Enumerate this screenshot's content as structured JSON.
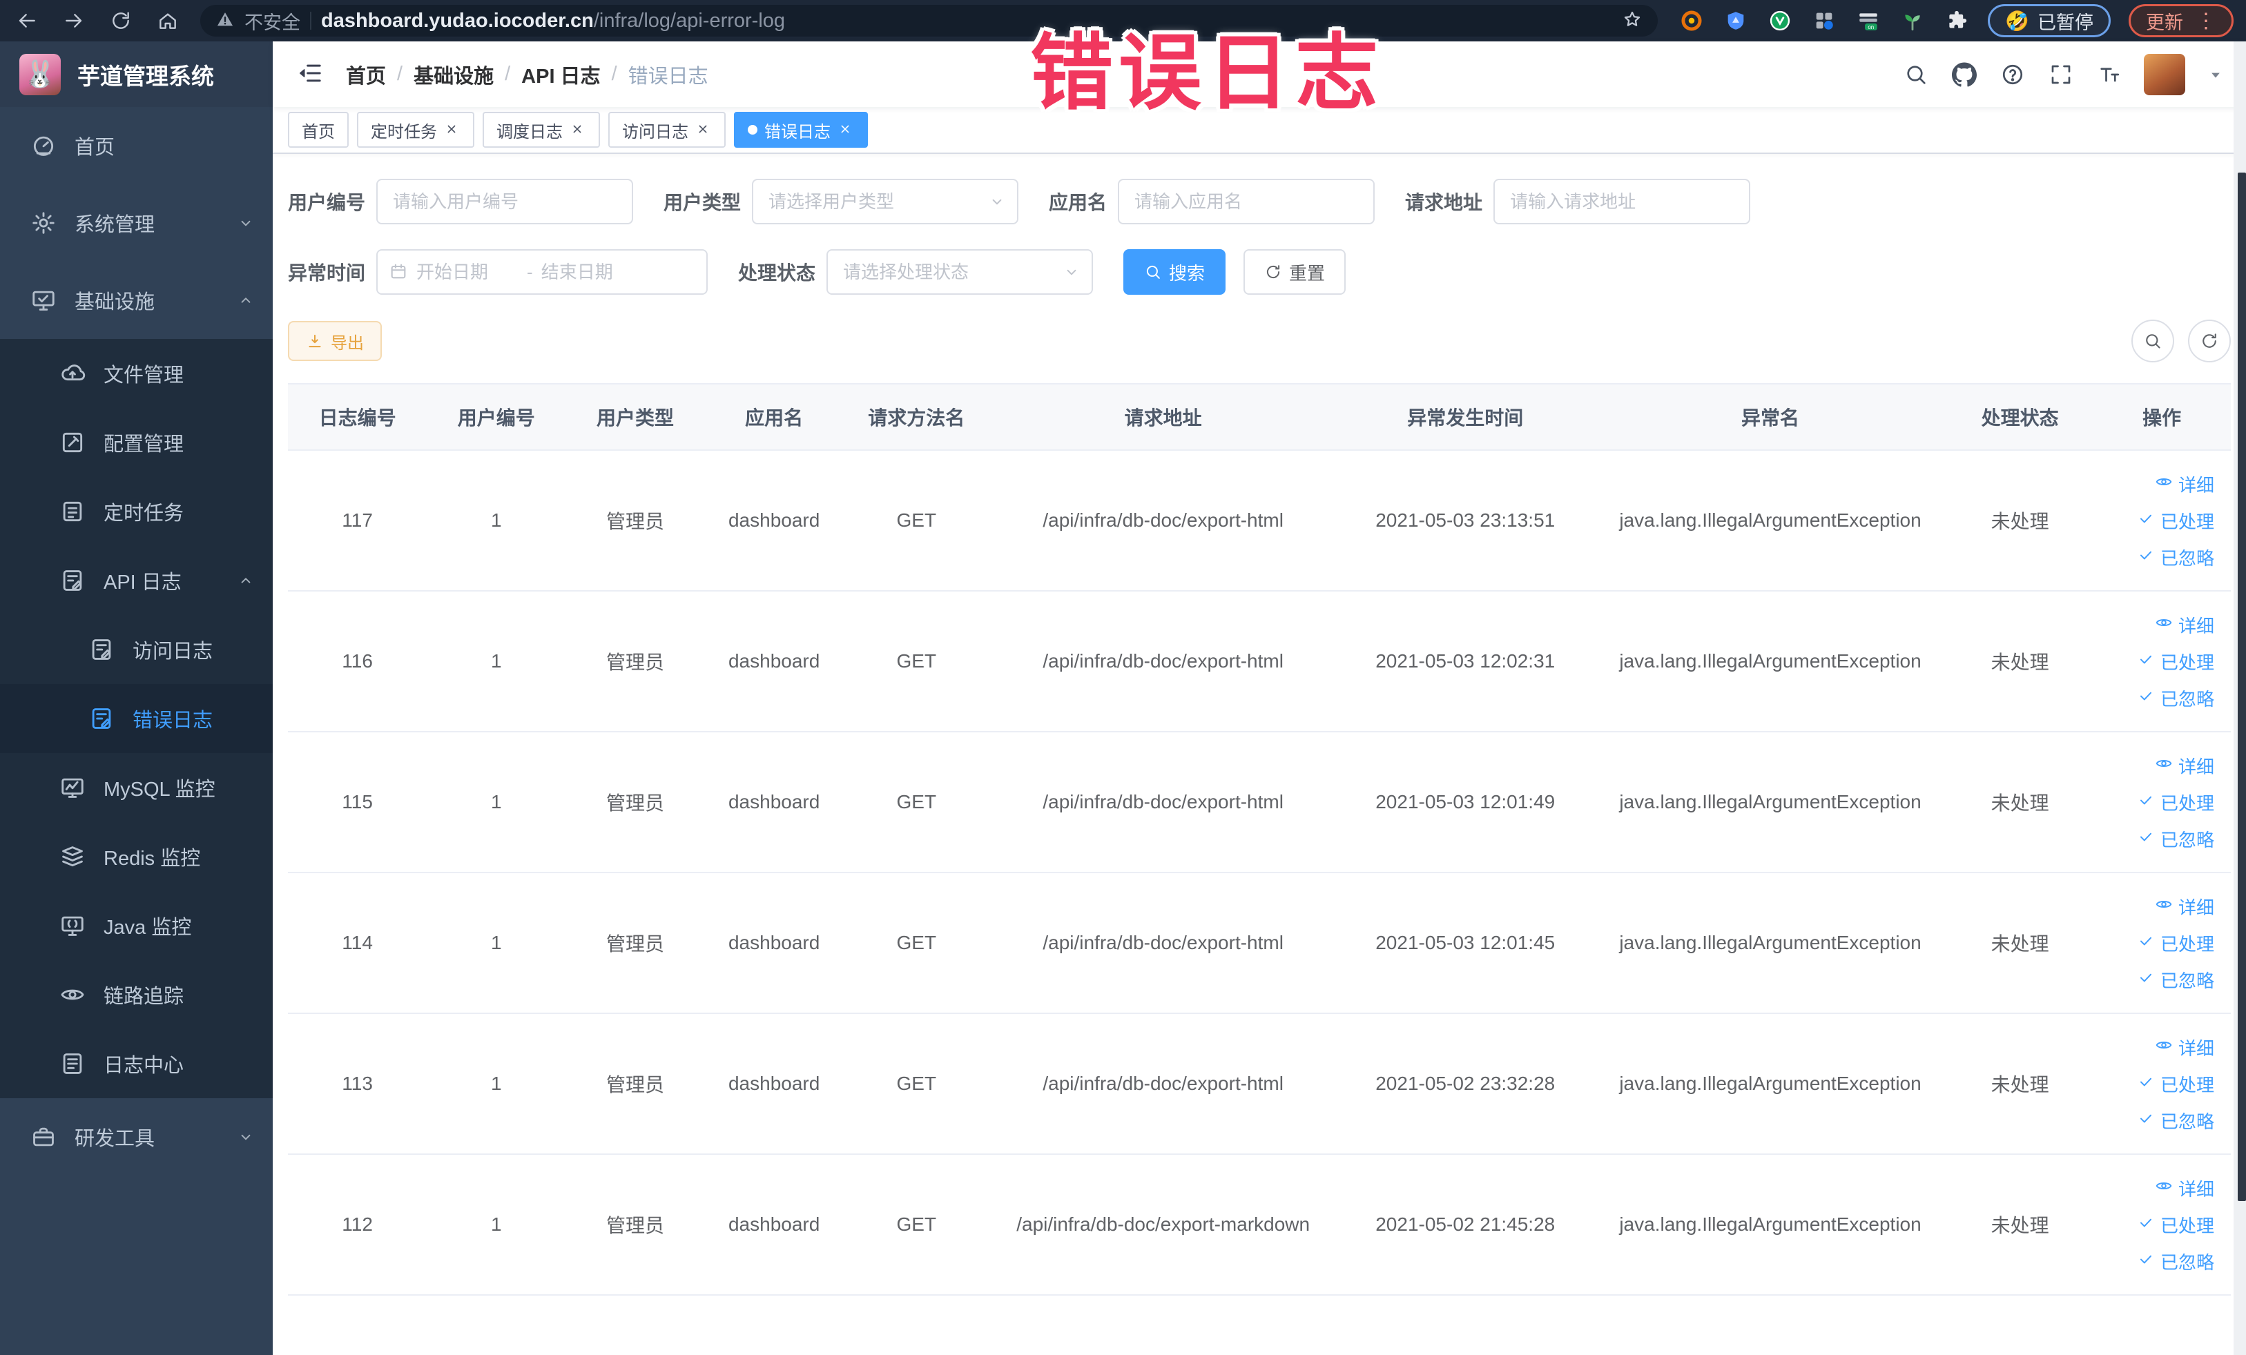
{
  "overlay": {
    "text": "错误日志",
    "color": "#f1375e"
  },
  "browser": {
    "security_label": "不安全",
    "url_domain": "dashboard.yudao.iocoder.cn",
    "url_path": "/infra/log/api-error-log",
    "paused_emoji": "🤣",
    "paused_badge": "已暂停",
    "update_button": "更新",
    "menu_dots": "⋮"
  },
  "app": {
    "title": "芋道管理系统",
    "logo_emoji": "🐰",
    "accent_color": "#409eff",
    "sidebar_color": "#304156",
    "submenu_color": "#1f2d3d"
  },
  "breadcrumb": {
    "separator": "/",
    "items": [
      {
        "label": "首页",
        "current": false
      },
      {
        "label": "基础设施",
        "current": false
      },
      {
        "label": "API 日志",
        "current": false
      },
      {
        "label": "错误日志",
        "current": true
      }
    ]
  },
  "tabs": [
    {
      "label": "首页",
      "closable": false,
      "active": false
    },
    {
      "label": "定时任务",
      "closable": true,
      "active": false
    },
    {
      "label": "调度日志",
      "closable": true,
      "active": false
    },
    {
      "label": "访问日志",
      "closable": true,
      "active": false
    },
    {
      "label": "错误日志",
      "closable": true,
      "active": true
    }
  ],
  "sidebar": {
    "items": [
      {
        "id": "home",
        "label": "首页",
        "icon": "dashboard-icon",
        "level": 0,
        "dark": false,
        "active": false,
        "chevron": null
      },
      {
        "id": "system",
        "label": "系统管理",
        "icon": "gear-icon",
        "level": 0,
        "dark": false,
        "active": false,
        "chevron": "down"
      },
      {
        "id": "infra",
        "label": "基础设施",
        "icon": "infra-icon",
        "level": 0,
        "dark": false,
        "active": false,
        "chevron": "up"
      },
      {
        "id": "file",
        "label": "文件管理",
        "icon": "upload-cloud-icon",
        "level": 1,
        "dark": true,
        "active": false,
        "chevron": null
      },
      {
        "id": "config",
        "label": "配置管理",
        "icon": "edit-square-icon",
        "level": 1,
        "dark": true,
        "active": false,
        "chevron": null
      },
      {
        "id": "job",
        "label": "定时任务",
        "icon": "task-list-icon",
        "level": 1,
        "dark": true,
        "active": false,
        "chevron": null
      },
      {
        "id": "api-log",
        "label": "API 日志",
        "icon": "log-edit-icon",
        "level": 1,
        "dark": true,
        "active": false,
        "chevron": "up"
      },
      {
        "id": "access-log",
        "label": "访问日志",
        "icon": "log-edit-icon",
        "level": 2,
        "dark": true,
        "active": false,
        "chevron": null
      },
      {
        "id": "error-log",
        "label": "错误日志",
        "icon": "log-edit-icon",
        "level": 2,
        "dark": true,
        "active": true,
        "chevron": null
      },
      {
        "id": "mysql",
        "label": "MySQL 监控",
        "icon": "chart-monitor-icon",
        "level": 1,
        "dark": true,
        "active": false,
        "chevron": null
      },
      {
        "id": "redis",
        "label": "Redis 监控",
        "icon": "layers-icon",
        "level": 1,
        "dark": true,
        "active": false,
        "chevron": null
      },
      {
        "id": "java",
        "label": "Java 监控",
        "icon": "java-monitor-icon",
        "level": 1,
        "dark": true,
        "active": false,
        "chevron": null
      },
      {
        "id": "tracer",
        "label": "链路追踪",
        "icon": "eye-icon",
        "level": 1,
        "dark": true,
        "active": false,
        "chevron": null
      },
      {
        "id": "log-center",
        "label": "日志中心",
        "icon": "log-center-icon",
        "level": 1,
        "dark": true,
        "active": false,
        "chevron": null
      },
      {
        "id": "dev-tools",
        "label": "研发工具",
        "icon": "briefcase-icon",
        "level": 0,
        "dark": false,
        "active": false,
        "chevron": "down"
      }
    ]
  },
  "filters": {
    "user_id": {
      "label": "用户编号",
      "placeholder": "请输入用户编号",
      "value": ""
    },
    "user_type": {
      "label": "用户类型",
      "placeholder": "请选择用户类型",
      "value": ""
    },
    "app_name": {
      "label": "应用名",
      "placeholder": "请输入应用名",
      "value": ""
    },
    "request_url": {
      "label": "请求地址",
      "placeholder": "请输入请求地址",
      "value": ""
    },
    "exception_time": {
      "label": "异常时间",
      "start_placeholder": "开始日期",
      "separator": "-",
      "end_placeholder": "结束日期"
    },
    "process_status": {
      "label": "处理状态",
      "placeholder": "请选择处理状态",
      "value": ""
    },
    "search_button": "搜索",
    "reset_button": "重置"
  },
  "toolbar": {
    "export_button": "导出"
  },
  "table": {
    "headers": [
      "日志编号",
      "用户编号",
      "用户类型",
      "应用名",
      "请求方法名",
      "请求地址",
      "异常发生时间",
      "异常名",
      "处理状态",
      "操作"
    ],
    "actions": [
      {
        "id": "detail",
        "label": "详细",
        "icon": "eye-icon"
      },
      {
        "id": "processed",
        "label": "已处理",
        "icon": "check-icon"
      },
      {
        "id": "ignored",
        "label": "已忽略",
        "icon": "check-icon"
      }
    ],
    "rows": [
      {
        "id": "117",
        "user_id": "1",
        "user_type": "管理员",
        "app": "dashboard",
        "method": "GET",
        "url": "/api/infra/db-doc/export-html",
        "time": "2021-05-03 23:13:51",
        "exception": "java.lang.IllegalArgumentException",
        "status": "未处理"
      },
      {
        "id": "116",
        "user_id": "1",
        "user_type": "管理员",
        "app": "dashboard",
        "method": "GET",
        "url": "/api/infra/db-doc/export-html",
        "time": "2021-05-03 12:02:31",
        "exception": "java.lang.IllegalArgumentException",
        "status": "未处理"
      },
      {
        "id": "115",
        "user_id": "1",
        "user_type": "管理员",
        "app": "dashboard",
        "method": "GET",
        "url": "/api/infra/db-doc/export-html",
        "time": "2021-05-03 12:01:49",
        "exception": "java.lang.IllegalArgumentException",
        "status": "未处理"
      },
      {
        "id": "114",
        "user_id": "1",
        "user_type": "管理员",
        "app": "dashboard",
        "method": "GET",
        "url": "/api/infra/db-doc/export-html",
        "time": "2021-05-03 12:01:45",
        "exception": "java.lang.IllegalArgumentException",
        "status": "未处理"
      },
      {
        "id": "113",
        "user_id": "1",
        "user_type": "管理员",
        "app": "dashboard",
        "method": "GET",
        "url": "/api/infra/db-doc/export-html",
        "time": "2021-05-02 23:32:28",
        "exception": "java.lang.IllegalArgumentException",
        "status": "未处理"
      },
      {
        "id": "112",
        "user_id": "1",
        "user_type": "管理员",
        "app": "dashboard",
        "method": "GET",
        "url": "/api/infra/db-doc/export-markdown",
        "time": "2021-05-02 21:45:28",
        "exception": "java.lang.IllegalArgumentException",
        "status": "未处理"
      }
    ]
  }
}
